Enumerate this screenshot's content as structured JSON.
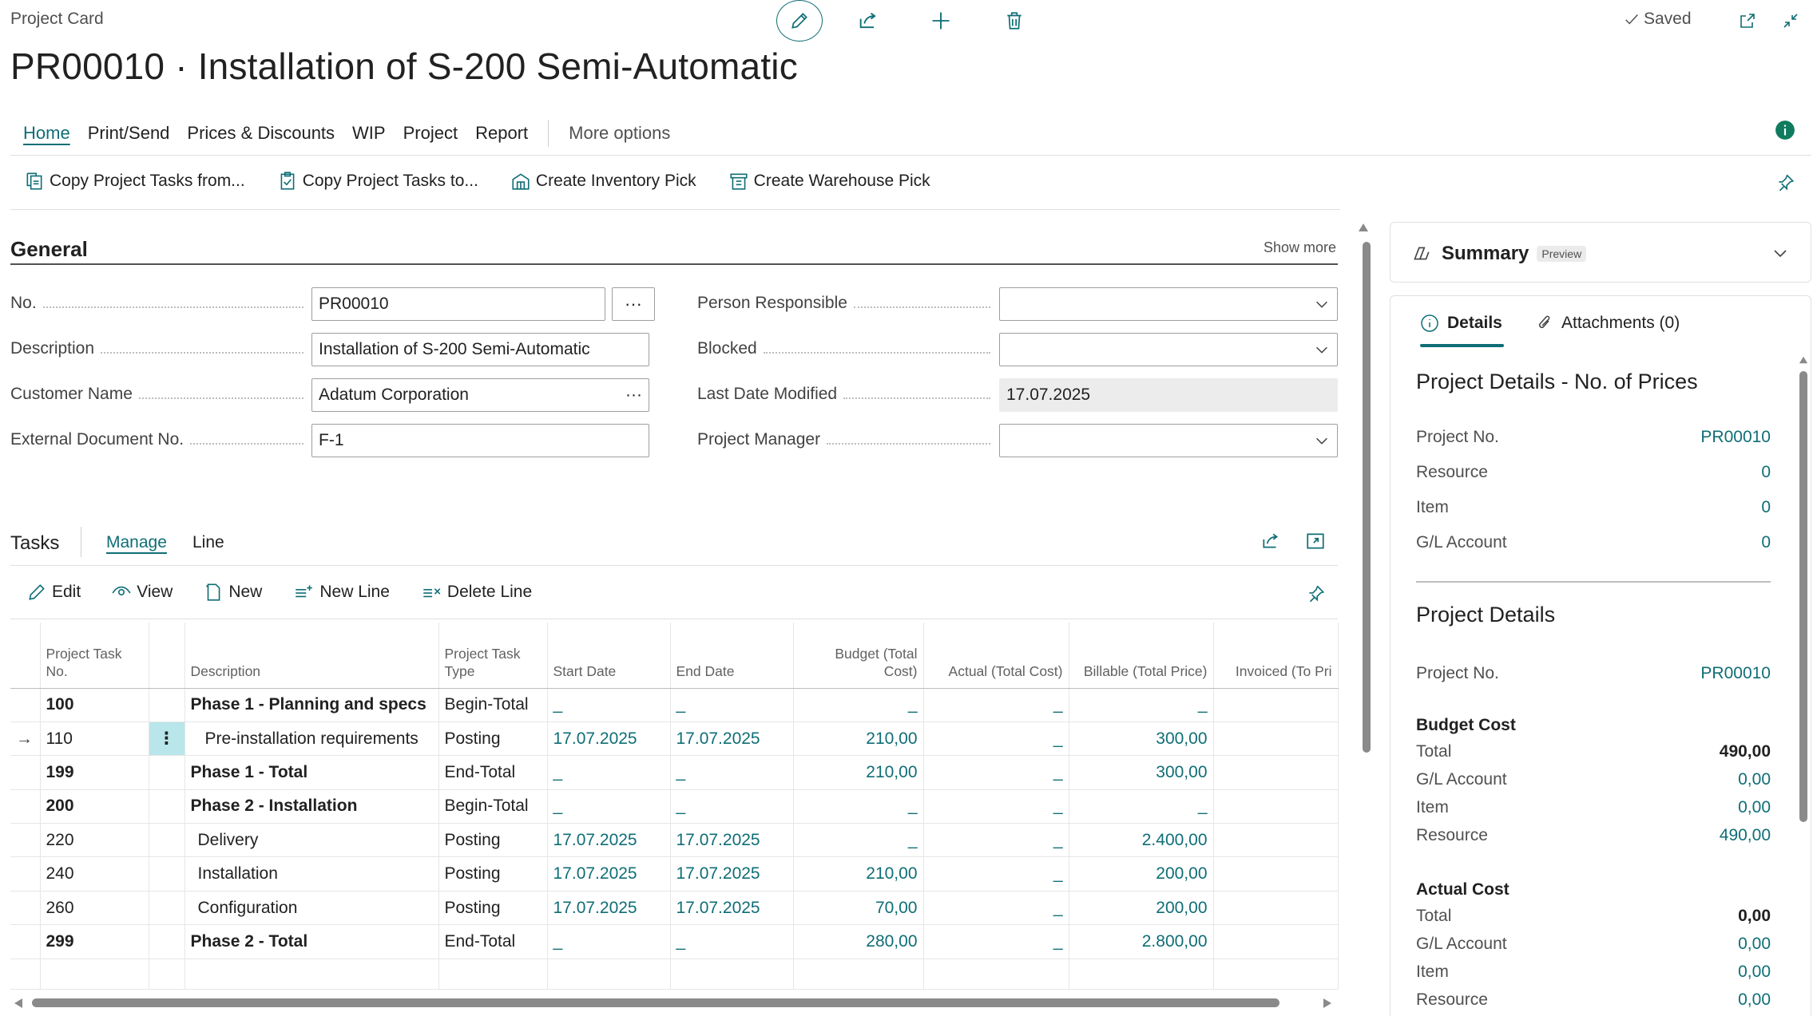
{
  "header": {
    "breadcrumb": "Project Card",
    "title": "PR00010 · Installation of S-200 Semi-Automatic",
    "saved_label": "Saved"
  },
  "tabs": [
    "Home",
    "Print/Send",
    "Prices & Discounts",
    "WIP",
    "Project",
    "Report"
  ],
  "more_options": "More options",
  "actions": [
    "Copy Project Tasks from...",
    "Copy Project Tasks to...",
    "Create Inventory Pick",
    "Create Warehouse Pick"
  ],
  "general": {
    "title": "General",
    "show_more": "Show more",
    "left_fields": [
      {
        "label": "No.",
        "value": "PR00010"
      },
      {
        "label": "Description",
        "value": "Installation of S-200 Semi-Automatic"
      },
      {
        "label": "Customer Name",
        "value": "Adatum Corporation"
      },
      {
        "label": "External Document No.",
        "value": "F-1"
      }
    ],
    "right_fields": [
      {
        "label": "Person Responsible",
        "value": ""
      },
      {
        "label": "Blocked",
        "value": ""
      },
      {
        "label": "Last Date Modified",
        "value": "17.07.2025"
      },
      {
        "label": "Project Manager",
        "value": ""
      }
    ]
  },
  "tasks": {
    "title": "Tasks",
    "tabs": [
      "Manage",
      "Line"
    ],
    "actions": [
      "Edit",
      "View",
      "New",
      "New Line",
      "Delete Line"
    ],
    "columns": [
      "Project Task No.",
      "Description",
      "Project Task Type",
      "Start Date",
      "End Date",
      "Budget (Total Cost)",
      "Actual (Total Cost)",
      "Billable (Total Price)",
      "Invoiced (To Pri"
    ],
    "rows": [
      {
        "no": "100",
        "desc": "Phase 1 - Planning and specs",
        "type": "Begin-Total",
        "start": "_",
        "end": "_",
        "budget": "_",
        "actual": "_",
        "billable": "_",
        "bold": true,
        "indent": 0
      },
      {
        "no": "110",
        "desc": "Pre-installation requirements",
        "type": "Posting",
        "start": "17.07.2025",
        "end": "17.07.2025",
        "budget": "210,00",
        "actual": "_",
        "billable": "300,00",
        "bold": false,
        "indent": 2,
        "current": true
      },
      {
        "no": "199",
        "desc": "Phase 1 - Total",
        "type": "End-Total",
        "start": "_",
        "end": "_",
        "budget": "210,00",
        "actual": "_",
        "billable": "300,00",
        "bold": true,
        "indent": 0
      },
      {
        "no": "200",
        "desc": "Phase 2 - Installation",
        "type": "Begin-Total",
        "start": "_",
        "end": "_",
        "budget": "_",
        "actual": "_",
        "billable": "_",
        "bold": true,
        "indent": 0
      },
      {
        "no": "220",
        "desc": "Delivery",
        "type": "Posting",
        "start": "17.07.2025",
        "end": "17.07.2025",
        "budget": "_",
        "actual": "_",
        "billable": "2.400,00",
        "bold": false,
        "indent": 1
      },
      {
        "no": "240",
        "desc": "Installation",
        "type": "Posting",
        "start": "17.07.2025",
        "end": "17.07.2025",
        "budget": "210,00",
        "actual": "_",
        "billable": "200,00",
        "bold": false,
        "indent": 1
      },
      {
        "no": "260",
        "desc": "Configuration",
        "type": "Posting",
        "start": "17.07.2025",
        "end": "17.07.2025",
        "budget": "70,00",
        "actual": "_",
        "billable": "200,00",
        "bold": false,
        "indent": 1
      },
      {
        "no": "299",
        "desc": "Phase 2 - Total",
        "type": "End-Total",
        "start": "_",
        "end": "_",
        "budget": "280,00",
        "actual": "_",
        "billable": "2.800,00",
        "bold": true,
        "indent": 0
      }
    ]
  },
  "factbox": {
    "summary_title": "Summary",
    "preview_badge": "Preview",
    "tab_details": "Details",
    "tab_attachments": "Attachments (0)",
    "prices_heading": "Project Details - No. of Prices",
    "prices_rows": [
      {
        "label": "Project No.",
        "value": "PR00010"
      },
      {
        "label": "Resource",
        "value": "0"
      },
      {
        "label": "Item",
        "value": "0"
      },
      {
        "label": "G/L Account",
        "value": "0"
      }
    ],
    "details_heading": "Project Details",
    "details_project_no": {
      "label": "Project No.",
      "value": "PR00010"
    },
    "budget_cost_title": "Budget Cost",
    "budget_rows": [
      {
        "label": "Total",
        "value": "490,00"
      },
      {
        "label": "G/L Account",
        "value": "0,00"
      },
      {
        "label": "Item",
        "value": "0,00"
      },
      {
        "label": "Resource",
        "value": "490,00"
      }
    ],
    "actual_cost_title": "Actual Cost",
    "actual_rows": [
      {
        "label": "Total",
        "value": "0,00"
      },
      {
        "label": "G/L Account",
        "value": "0,00"
      },
      {
        "label": "Item",
        "value": "0,00"
      },
      {
        "label": "Resource",
        "value": "0,00"
      }
    ]
  },
  "colors": {
    "accent": "#0f6e76",
    "selection": "#b8e6ea"
  }
}
